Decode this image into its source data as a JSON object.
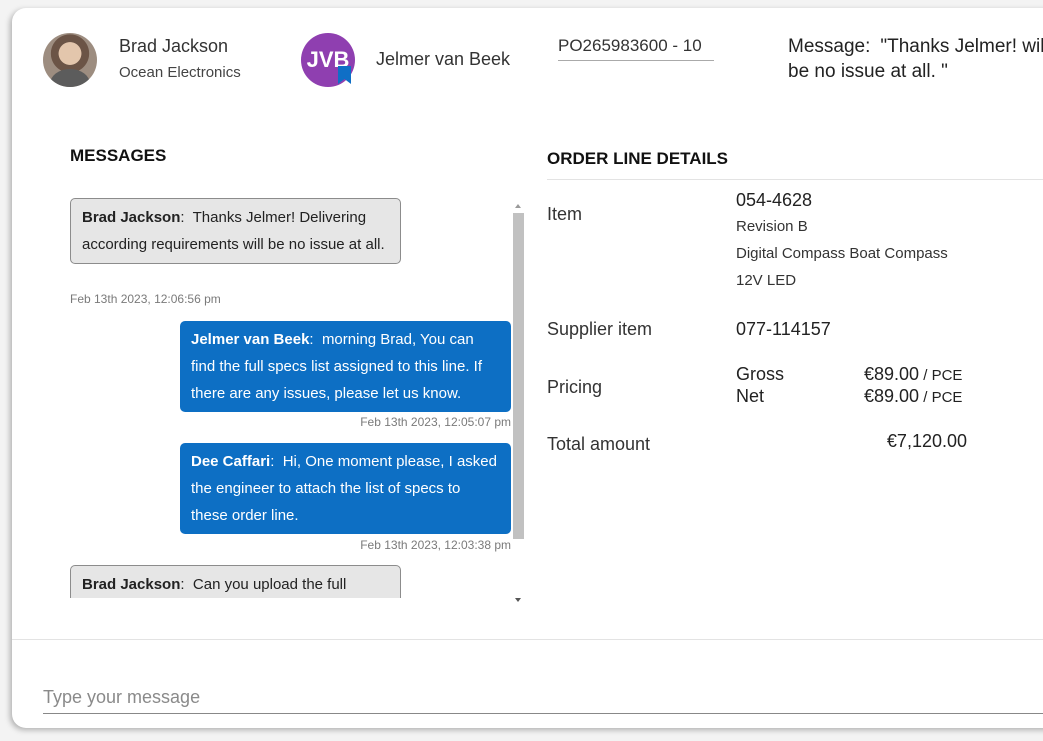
{
  "header": {
    "contact": {
      "name": "Brad Jackson",
      "company": "Ocean Electronics"
    },
    "buyer": {
      "initials": "JVB",
      "name": "Jelmer van Beek"
    },
    "po_number": "PO265983600 - 10",
    "message_label": "Message:",
    "message_preview": "\"Thanks Jelmer! will be no issue at all. \""
  },
  "messages": {
    "title": "MESSAGES",
    "items": [
      {
        "author": "Brad Jackson",
        "sep": ":",
        "text": "Thanks Jelmer! Delivering according requirements will be no issue at all.",
        "time": "Feb 13th 2023, 12:06:56 pm",
        "direction": "in"
      },
      {
        "author": "Jelmer van Beek",
        "sep": ":",
        "text": "morning Brad, You can find the full specs list assigned to this line. If there are any issues, please let us know.",
        "time": "Feb 13th 2023, 12:05:07 pm",
        "direction": "out"
      },
      {
        "author": "Dee Caffari",
        "sep": ":",
        "text": "Hi, One moment please, I asked the engineer to attach the list of specs to these order line.",
        "time": "Feb 13th 2023, 12:03:38 pm",
        "direction": "out"
      },
      {
        "author": "Brad Jackson",
        "sep": ":",
        "text": "Can you upload the full",
        "time": "",
        "direction": "in"
      }
    ]
  },
  "order": {
    "title": "ORDER LINE DETAILS",
    "item_label": "Item",
    "item_number": "054-4628",
    "revision": "Revision  B",
    "description_1": "Digital Compass Boat Compass",
    "description_2": "12V LED",
    "supplier_item_label": "Supplier item",
    "supplier_item": "077-114157",
    "pricing_label": "Pricing",
    "gross_label": "Gross",
    "gross_price": "€89.00",
    "net_label": "Net",
    "net_price": "€89.00",
    "unit": " / PCE",
    "total_label": "Total amount",
    "total": "€7,120.00"
  },
  "composer": {
    "placeholder": "Type your message"
  },
  "colors": {
    "accent": "#0d6fc4",
    "avatar": "#8f3fb0"
  }
}
